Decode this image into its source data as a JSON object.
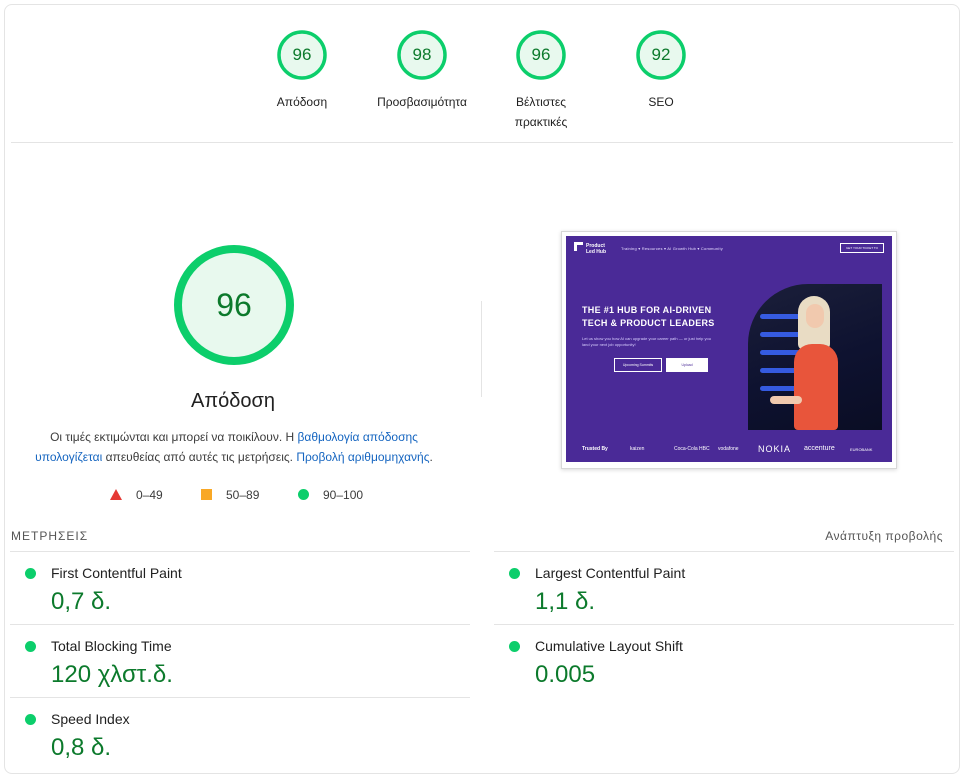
{
  "colors": {
    "pass": "#0cce6b",
    "pass_text": "#0c7a2c",
    "average": "#f9a825",
    "fail": "#e53935",
    "link": "#1565c0"
  },
  "gauges": [
    {
      "score": "96",
      "label": "Απόδοση"
    },
    {
      "score": "98",
      "label": "Προσβασιμότητα"
    },
    {
      "score": "96",
      "label": "Βέλτιστες πρακτικές"
    },
    {
      "score": "92",
      "label": "SEO"
    }
  ],
  "performance": {
    "score": "96",
    "title": "Απόδοση",
    "desc_part1": "Οι τιμές εκτιμώνται και μπορεί να ποικίλουν. Η ",
    "desc_link1": "βαθμολογία απόδοσης υπολογίζεται",
    "desc_part2": " απευθείας από αυτές τις μετρήσεις. ",
    "desc_link2": "Προβολή αριθμομηχανής",
    "desc_part3": "."
  },
  "legend": {
    "fail": "0–49",
    "average": "50–89",
    "pass": "90–100"
  },
  "screenshot": {
    "brand": "Product Led Hub",
    "nav_links": "Training ▾   Resources ▾   AI Growth Hub ▾   Community",
    "nav_button": "GET YOUR TICKET TO",
    "hero_title_1": "THE #1 HUB FOR AI-DRIVEN",
    "hero_title_2": "TECH & PRODUCT LEADERS",
    "hero_sub": "Let us show you how AI can upgrade your career path — or just help you land your next job opportunity!",
    "button_1": "Upcoming Summits",
    "button_2": "Upload",
    "trusted_label": "Trusted By",
    "logos": [
      "kaizen",
      "Coca-Cola HBC",
      "vodafone",
      "NOKIA",
      "accenture",
      "EUROBANK"
    ]
  },
  "metrics": {
    "heading": "ΜΕΤΡΗΣΕΙΣ",
    "expand_label": "Ανάπτυξη προβολής",
    "items": [
      {
        "name": "First Contentful Paint",
        "value": "0,7 δ."
      },
      {
        "name": "Largest Contentful Paint",
        "value": "1,1 δ."
      },
      {
        "name": "Total Blocking Time",
        "value": "120 χλστ.δ."
      },
      {
        "name": "Cumulative Layout Shift",
        "value": "0.005"
      },
      {
        "name": "Speed Index",
        "value": "0,8 δ."
      }
    ]
  }
}
